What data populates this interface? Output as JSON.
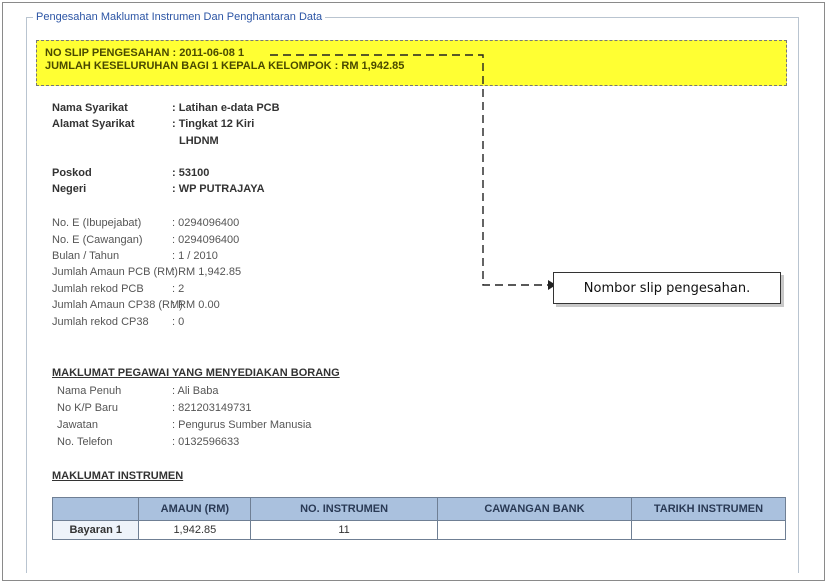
{
  "section_legend": "Pengesahan Maklumat Instrumen Dan Penghantaran Data",
  "slip": {
    "line1": "NO SLIP PENGESAHAN : 2011-06-08 1",
    "line2": "JUMLAH KESELURUHAN BAGI 1 KEPALA KELOMPOK : RM 1,942.85"
  },
  "company": [
    {
      "label": "Nama Syarikat",
      "value": ": Latihan e-data PCB"
    },
    {
      "label": "Alamat Syarikat",
      "value": ": Tingkat 12 Kiri"
    },
    {
      "label": "",
      "value": "LHDNM"
    },
    {
      "label": "Poskod",
      "value": ": 53100"
    },
    {
      "label": "Negeri",
      "value": ": WP PUTRAJAYA"
    }
  ],
  "details": [
    {
      "label": "No. E (Ibupejabat)",
      "value": ": 0294096400"
    },
    {
      "label": "No. E (Cawangan)",
      "value": ": 0294096400"
    },
    {
      "label": "Bulan / Tahun",
      "value": ": 1 / 2010"
    },
    {
      "label": "Jumlah Amaun PCB (RM)",
      "value": ": RM 1,942.85"
    },
    {
      "label": "Jumlah rekod PCB",
      "value": ": 2"
    },
    {
      "label": "Jumlah Amaun CP38 (RM)",
      "value": ": RM 0.00"
    },
    {
      "label": "Jumlah rekod CP38",
      "value": ": 0"
    }
  ],
  "preparer": {
    "title": "MAKLUMAT PEGAWAI YANG MENYEDIAKAN BORANG",
    "rows": [
      {
        "label": "Nama Penuh",
        "value": ": Ali Baba"
      },
      {
        "label": "No K/P Baru",
        "value": ": 821203149731"
      },
      {
        "label": "Jawatan",
        "value": ": Pengurus Sumber Manusia"
      },
      {
        "label": "No. Telefon",
        "value": ": 0132596633"
      }
    ]
  },
  "instrument": {
    "title": "MAKLUMAT INSTRUMEN",
    "headers": [
      "",
      "AMAUN (RM)",
      "NO. INSTRUMEN",
      "CAWANGAN BANK",
      "TARIKH INSTRUMEN"
    ],
    "rows": [
      [
        "Bayaran 1",
        "1,942.85",
        "11",
        "",
        ""
      ]
    ]
  },
  "callout_text": "Nombor slip pengesahan."
}
